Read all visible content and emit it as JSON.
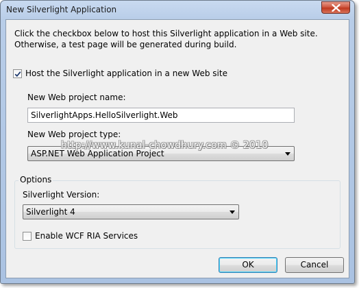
{
  "window": {
    "title": "New Silverlight Application"
  },
  "intro_text": "Click the checkbox below to host this Silverlight application in a Web site. Otherwise, a test page will be generated during build.",
  "host_checkbox": {
    "label": "Host the Silverlight application in a new Web site",
    "checked": true
  },
  "web_project_name": {
    "label": "New Web project name:",
    "value": "SilverlightApps.HelloSilverlight.Web"
  },
  "web_project_type": {
    "label": "New Web project type:",
    "selected": "ASP.NET Web Application Project"
  },
  "watermark": "http://www.kunal-chowdhury.com © 2010",
  "options": {
    "legend": "Options",
    "silverlight_version_label": "Silverlight Version:",
    "silverlight_version_selected": "Silverlight 4",
    "wcf_ria_label": "Enable WCF RIA Services",
    "wcf_ria_checked": false
  },
  "buttons": {
    "ok": "OK",
    "cancel": "Cancel"
  },
  "icons": {
    "close": "close-icon",
    "check": "checkmark-icon",
    "dropdown": "chevron-down-icon"
  }
}
